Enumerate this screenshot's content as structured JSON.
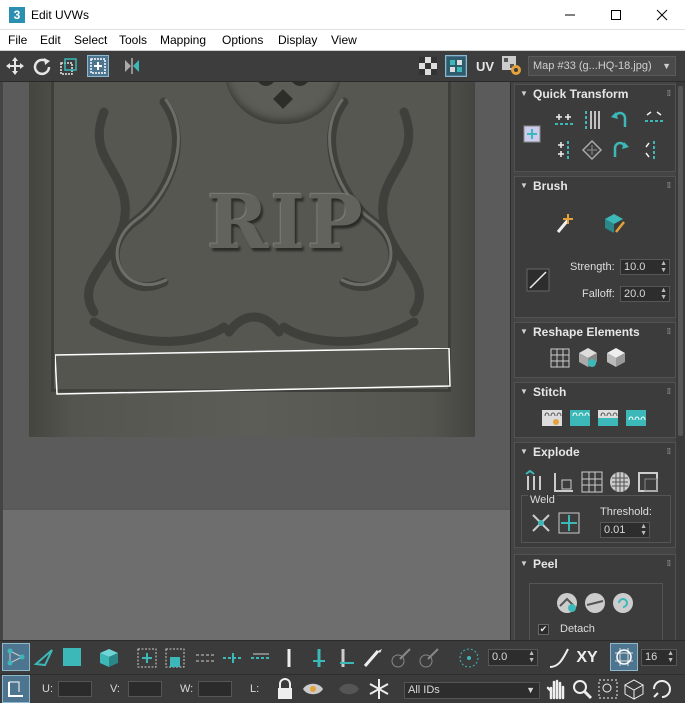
{
  "window": {
    "title": "Edit UVWs",
    "app_icon": "3"
  },
  "menu": [
    "File",
    "Edit",
    "Select",
    "Tools",
    "Mapping",
    "Options",
    "Display",
    "View"
  ],
  "toolbar": {
    "uv_label": "UV",
    "map_select": "Map #33 (g...HQ-18.jpg)"
  },
  "viewport": {
    "texture_text": "RIP"
  },
  "panel": {
    "quick_transform": {
      "title": "Quick Transform"
    },
    "brush": {
      "title": "Brush",
      "strength_label": "Strength:",
      "strength_value": "10.0",
      "falloff_label": "Falloff:",
      "falloff_value": "20.0"
    },
    "reshape": {
      "title": "Reshape Elements"
    },
    "stitch": {
      "title": "Stitch"
    },
    "explode": {
      "title": "Explode",
      "weld_label": "Weld",
      "threshold_label": "Threshold:",
      "threshold_value": "0.01"
    },
    "peel": {
      "title": "Peel",
      "detach_label": "Detach",
      "detach_checked": true
    }
  },
  "bottom": {
    "angle_value": "0.0",
    "xy_label": "XY",
    "grid_value": "16",
    "u_label": "U:",
    "v_label": "V:",
    "w_label": "W:",
    "l_label": "L:",
    "ids_select": "All IDs"
  },
  "colors": {
    "accent": "#3cb8b8",
    "panel_bg": "#444444",
    "active_tool": "#4e7590"
  }
}
